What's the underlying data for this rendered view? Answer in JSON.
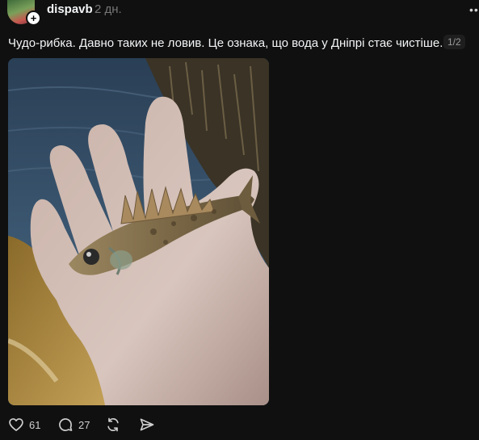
{
  "post": {
    "author": {
      "username": "dispavb",
      "avatar_icon": "user-avatar",
      "follow_icon": "plus-icon"
    },
    "timestamp": "2 дн.",
    "caption": "Чудо-рибка. Давно таких не ловив. Це ознака, що вода у Дніпрі стає чистіше.",
    "media_counter": "1/2",
    "media": {
      "type": "photo",
      "subject": "fish-in-hand"
    },
    "actions": {
      "likes": "61",
      "comments": "27",
      "like_icon": "heart-icon",
      "comment_icon": "comment-bubble-icon",
      "repost_icon": "repost-icon",
      "share_icon": "send-icon"
    }
  },
  "colors": {
    "background": "#101010",
    "text_primary": "#f3f5f7",
    "text_secondary": "#777777"
  }
}
